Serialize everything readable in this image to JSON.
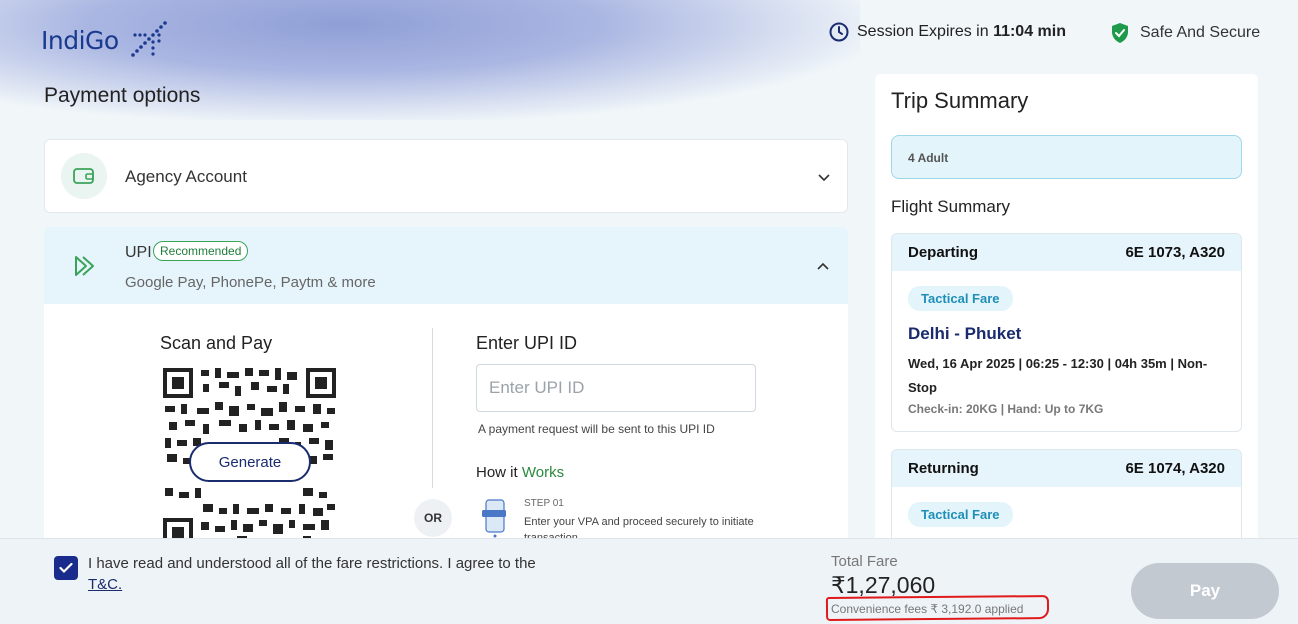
{
  "header": {
    "logo_text": "IndiGo",
    "session_prefix": "Session Expires in ",
    "session_time": "11:04 min",
    "secure_text": "Safe And Secure"
  },
  "payment": {
    "title": "Payment options",
    "agency_label": "Agency Account",
    "upi": {
      "title": "UPI",
      "badge": "Recommended",
      "subtitle": "Google Pay, PhonePe, Paytm & more",
      "scan_title": "Scan and Pay",
      "generate_label": "Generate",
      "or_label": "OR",
      "enter_title": "Enter UPI ID",
      "input_placeholder": "Enter UPI ID",
      "input_value": "",
      "hint": "A payment request will be sent to this UPI ID",
      "how_prefix": "How it ",
      "how_suffix": "Works",
      "step_num": "STEP 01",
      "step_text": "Enter your VPA and proceed securely to initiate transaction"
    }
  },
  "trip": {
    "title": "Trip Summary",
    "passengers": "4 Adult",
    "flight_summary_label": "Flight Summary",
    "departing": {
      "label": "Departing",
      "flight": "6E 1073, A320",
      "fare": "Tactical Fare",
      "route": "Delhi - Phuket",
      "details": "Wed, 16 Apr 2025 | 06:25 - 12:30 | 04h 35m | Non-Stop",
      "baggage": "Check-in: 20KG | Hand: Up to 7KG"
    },
    "returning": {
      "label": "Returning",
      "flight": "6E 1074, A320",
      "fare": "Tactical Fare"
    }
  },
  "footer": {
    "agree_text": "I have read and understood all of the fare restrictions. I agree to the ",
    "tc_link": "T&C.",
    "total_label": "Total Fare",
    "total_amount": "₹1,27,060",
    "convenience": "Convenience fees ₹ 3,192.0 applied",
    "pay_label": "Pay"
  },
  "colors": {
    "brand": "#1a2b6e",
    "accent_green": "#2a8a3c",
    "annotation_red": "#e01a1a"
  },
  "icons": [
    "clock-icon",
    "shield-check-icon",
    "wallet-icon",
    "upi-arrow-icon",
    "chevron-down-icon",
    "chevron-up-icon",
    "checkmark-icon",
    "phone-step-icon",
    "logo-plane-icon"
  ]
}
